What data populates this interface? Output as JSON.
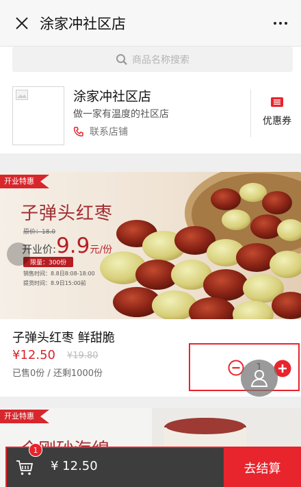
{
  "header": {
    "title": "涂家冲社区店",
    "close_icon": "close-icon",
    "more_icon": "more-icon"
  },
  "search": {
    "placeholder": "商品名称搜索",
    "icon": "search-icon"
  },
  "shop": {
    "name": "涂家冲社区店",
    "slogan": "做一家有温度的社区店",
    "contact_label": "联系店铺",
    "contact_icon": "phone-icon",
    "coupon_label": "优惠券",
    "coupon_icon": "coupon-icon",
    "logo_icon": "image-placeholder-icon"
  },
  "products": [
    {
      "ribbon": "开业特惠",
      "banner": {
        "title": "子弹头红枣",
        "orig_price": "原价：18.0",
        "price_label": "开业价:",
        "price": "9.9",
        "unit": "元/份",
        "limit": "限量：300份",
        "sale_time": "销售时间：8.8日8:08-18:00",
        "pickup_time": "提货时间：8.9日15:00前"
      },
      "name": "子弹头红枣 鲜甜脆",
      "price": "¥12.50",
      "orig_price": "¥19.80",
      "sold": "已售0份 / 还剩1000份",
      "quantity": "1"
    },
    {
      "ribbon": "开业特惠",
      "banner_title": "全刚砂海绵"
    }
  ],
  "cart": {
    "badge": "1",
    "total": "¥ 12.50",
    "checkout_label": "去结算",
    "icon": "cart-icon"
  },
  "colors": {
    "accent": "#e8242d",
    "bottom_bar": "#3d3d3d",
    "price_red": "#d8242c"
  }
}
